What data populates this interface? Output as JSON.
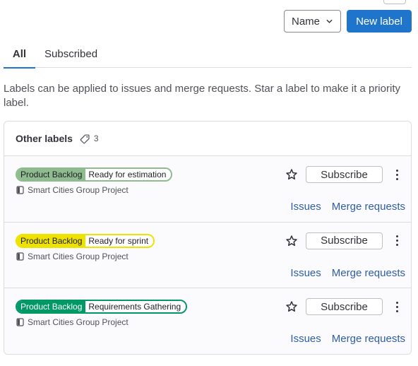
{
  "toolbar": {
    "sort_label": "Name",
    "new_label": "New label"
  },
  "tabs": [
    {
      "label": "All",
      "active": true
    },
    {
      "label": "Subscribed",
      "active": false
    }
  ],
  "description": "Labels can be applied to issues and merge requests. Star a label to make it a priority label.",
  "section": {
    "title": "Other labels",
    "count": "3"
  },
  "labels": [
    {
      "scope": "Product Backlog",
      "value": "Ready for estimation",
      "color": "#8fbc8f",
      "text_color": "#1f1e24",
      "project": "Smart Cities Group Project",
      "subscribe": "Subscribe",
      "issues": "Issues",
      "merge_requests": "Merge requests"
    },
    {
      "scope": "Product Backlog",
      "value": "Ready for sprint",
      "color": "#ede200",
      "text_color": "#1f1e24",
      "project": "Smart Cities Group Project",
      "subscribe": "Subscribe",
      "issues": "Issues",
      "merge_requests": "Merge requests"
    },
    {
      "scope": "Product Backlog",
      "value": "Requirements Gathering",
      "color": "#009966",
      "text_color": "#ffffff",
      "project": "Smart Cities Group Project",
      "subscribe": "Subscribe",
      "issues": "Issues",
      "merge_requests": "Merge requests"
    }
  ],
  "icons": {
    "sort": "chevron-down-icon",
    "count": "label-icon",
    "project": "project-icon",
    "star": "star-icon",
    "more": "ellipsis-v-icon"
  }
}
